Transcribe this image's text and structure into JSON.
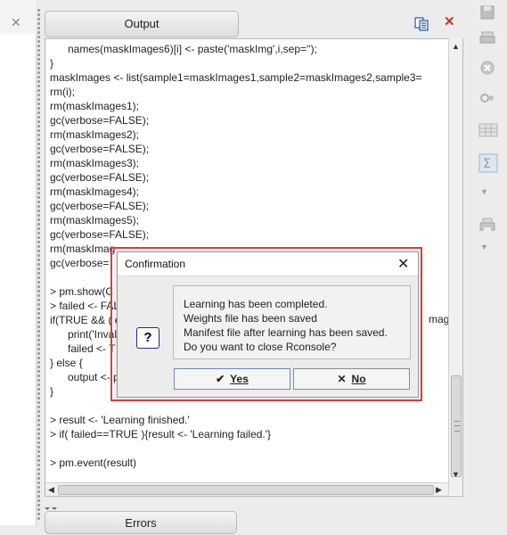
{
  "left_panel": {
    "close_glyph": "✕"
  },
  "output_panel": {
    "tab_label": "Output",
    "copy_icon": "copy-icon",
    "close_glyph": "✕",
    "console_lines": [
      "      names(maskImages6)[i] <- paste('maskImg',i,sep='');",
      "}",
      "maskImages <- list(sample1=maskImages1,sample2=maskImages2,sample3=",
      "rm(i);",
      "rm(maskImages1);",
      "gc(verbose=FALSE);",
      "rm(maskImages2);",
      "gc(verbose=FALSE);",
      "rm(maskImages3);",
      "gc(verbose=FALSE);",
      "rm(maskImages4);",
      "gc(verbose=FALSE);",
      "rm(maskImages5);",
      "gc(verbose=FALSE);",
      "rm(maskImag",
      "gc(verbose=",
      "",
      "> pm.show(C",
      "> failed <- FAL",
      "if(TRUE && ( e",
      "      print('Inval",
      "      failed <- T",
      "} else {",
      "      output <- p",
      "}",
      "",
      "> result <- 'Learning finished.'",
      "> if( failed==TRUE ){result <- 'Learning failed.'}",
      "",
      "> pm.event(result)"
    ],
    "clipped_fragment": "mages"
  },
  "errors_panel": {
    "tab_label": "Errors"
  },
  "right_toolbar": {
    "icons": [
      "save-icon",
      "print-icon",
      "cancel-circle-icon",
      "link-icon",
      "table-icon",
      "sum-icon",
      "dropdown-arrow-icon",
      "printer-icon",
      "dropdown-arrow-icon"
    ]
  },
  "dialog": {
    "title": "Confirmation",
    "close_glyph": "✕",
    "icon_glyph": "?",
    "message_lines": [
      "Learning has been completed.",
      "Weights file has been saved",
      "Manifest file after learning has been saved.",
      "Do you want to close Rconsole?"
    ],
    "yes_label": "Yes",
    "no_label": "No",
    "yes_glyph": "✔",
    "no_glyph": "✕"
  }
}
